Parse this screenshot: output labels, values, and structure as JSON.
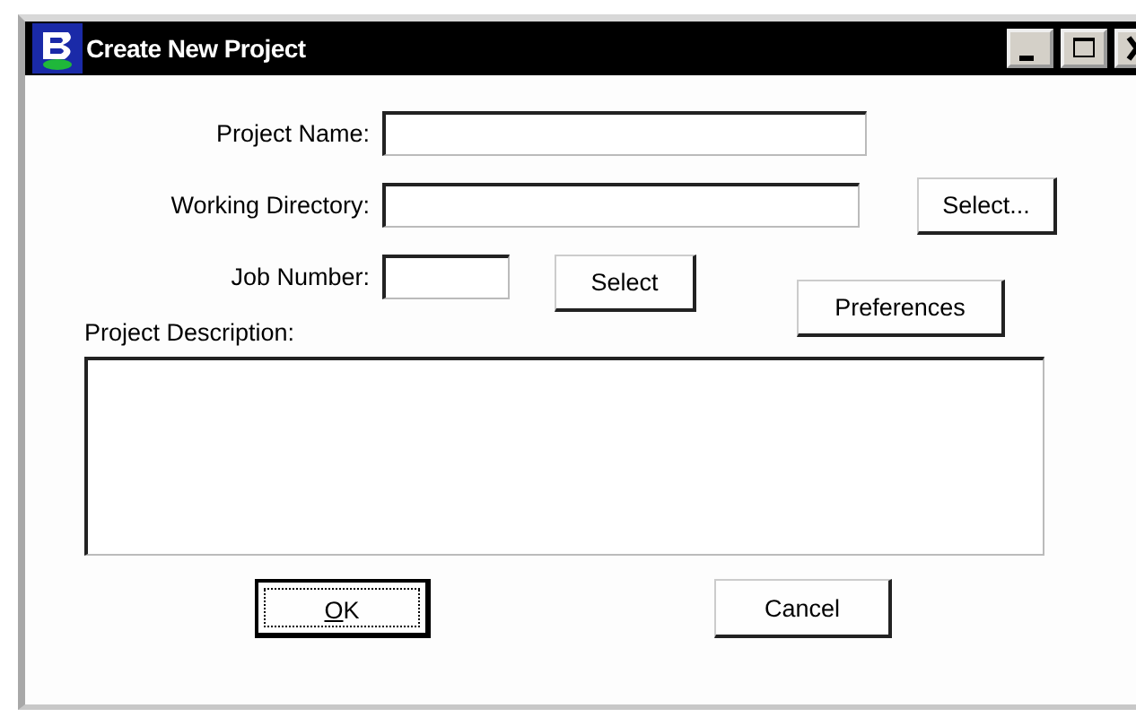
{
  "window": {
    "title": "Create New Project"
  },
  "fields": [
    {
      "label": "Project Name:",
      "kind": "long"
    },
    {
      "label": "Working Directory:",
      "kind": "medium"
    },
    {
      "label": "Job Number:",
      "kind": "short"
    }
  ],
  "buttons": {
    "select_directory": "Select...",
    "select_job": "Select",
    "preferences": "Preferences"
  },
  "description": {
    "label": "Project Description:"
  },
  "footer": [
    {
      "label": "OK",
      "default": true,
      "focused": true,
      "underline_first": true
    },
    {
      "label": "Cancel",
      "default": false,
      "focused": false,
      "underline_first": false
    }
  ]
}
